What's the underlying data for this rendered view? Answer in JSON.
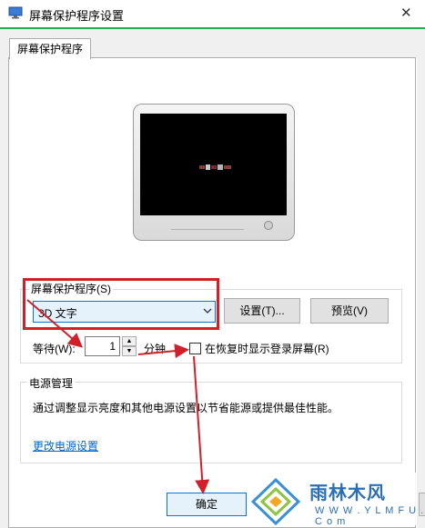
{
  "window": {
    "title": "屏幕保护程序设置",
    "close_glyph": "✕"
  },
  "tabs": [
    {
      "label": "屏幕保护程序"
    }
  ],
  "screensaver": {
    "group_label": "屏幕保护程序(S)",
    "selected": "3D 文字",
    "settings_button": "设置(T)...",
    "preview_button": "预览(V)",
    "wait_label": "等待(W):",
    "wait_value": "1",
    "wait_unit": "分钟",
    "resume_checkbox_label": "在恢复时显示登录屏幕(R)",
    "resume_checked": false
  },
  "power": {
    "group_label": "电源管理",
    "description": "通过调整显示亮度和其他电源设置以节省能源或提供最佳性能。",
    "link": "更改电源设置"
  },
  "footer": {
    "ok_button": "确定"
  },
  "watermark": {
    "main": "雨林木风",
    "sub": "W W W . Y L M F U . C o m"
  },
  "colors": {
    "annotation_red": "#d1202a",
    "accent_blue": "#0078d7",
    "title_green": "#22b04f",
    "link_blue": "#0066cc"
  },
  "icons": [
    "app-icon",
    "close-icon",
    "chevron-down-icon",
    "spin-up-icon",
    "spin-down-icon",
    "checkbox-icon",
    "monitor-preview",
    "watermark-logo-icon"
  ]
}
